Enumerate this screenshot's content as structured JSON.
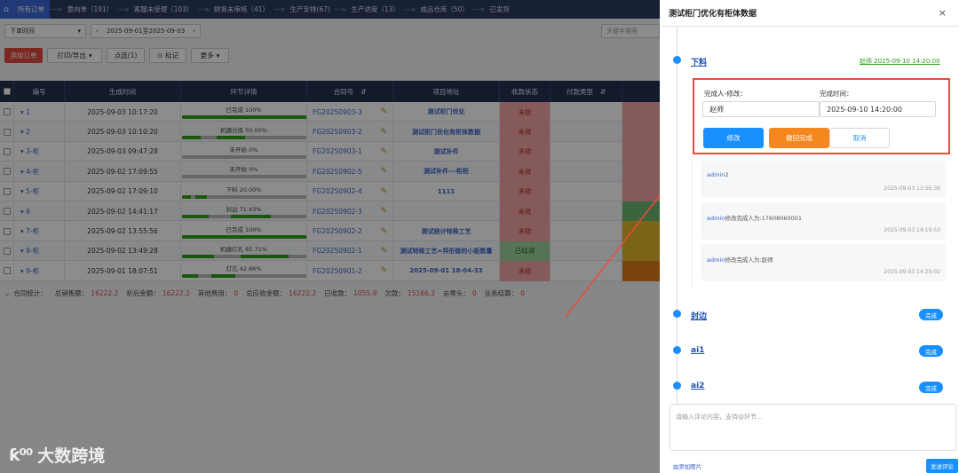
{
  "nav": {
    "home_icon": "home-icon",
    "tabs": [
      {
        "label": "所有订单",
        "active": true
      },
      {
        "label": "意向单（191）"
      },
      {
        "label": "客服未受理（103）"
      },
      {
        "label": "财务未审核（41）"
      },
      {
        "label": "生产安排(67)"
      },
      {
        "label": "生产进度（13）"
      },
      {
        "label": "成品仓库（50）"
      },
      {
        "label": "已发货"
      }
    ],
    "arrow": "--->"
  },
  "filters": {
    "time_select": "下单时间",
    "date_range": "2025-09-01至2025-09-03",
    "keyword_placeholder": "关键字搜索"
  },
  "toolbar": {
    "add": "添加订单",
    "print_export": "打印/导出",
    "pick": "点选(1)",
    "mark": "标记",
    "more": "更多"
  },
  "table": {
    "headers": [
      "编号",
      "生成时间",
      "环节详情",
      "合同号",
      "项目地址",
      "收款状态",
      "付款类型"
    ],
    "sort_icon": "⇵",
    "rows": [
      {
        "id": "1",
        "time": "2025-09-03 10:17:20",
        "stage": "已完成 100%",
        "progress": 1.0,
        "contract": "FG20250903-3",
        "project": "测试柜门优化",
        "status": "未收",
        "color": "#f2a4a4"
      },
      {
        "id": "2",
        "time": "2025-09-03 10:10:20",
        "stage": "机器分拣 50.00%",
        "progress": 0.5,
        "contract": "FG20250903-2",
        "project": "测试柜门优化有柜体数据",
        "status": "未收",
        "color": "#f2a4a4"
      },
      {
        "id": "3-柜",
        "time": "2025-09-03 09:47:28",
        "stage": "未开始 0%",
        "progress": 0,
        "contract": "FG20250903-1",
        "project": "测试补件",
        "status": "未收",
        "color": "#f2a4a4"
      },
      {
        "id": "4-柜",
        "time": "2025-09-02 17:09:55",
        "stage": "未开始 0%",
        "progress": 0,
        "contract": "FG20250902-5",
        "project": "测试补件---柜柜",
        "status": "未收",
        "color": "#f2a4a4"
      },
      {
        "id": "5-柜",
        "time": "2025-09-02 17:09:10",
        "stage": "下料 20.00%",
        "progress": 0.2,
        "contract": "FG20250902-4",
        "project": "1111",
        "status": "未收",
        "color": "#f2a4a4"
      },
      {
        "id": "6",
        "time": "2025-09-02 14:41:17",
        "stage": "封边 71.43%",
        "progress": 0.7143,
        "contract": "FG20250902-3",
        "project": "",
        "status": "未收",
        "color": "#6fb86f"
      },
      {
        "id": "7-柜",
        "time": "2025-09-02 13:55:56",
        "stage": "已完成 100%",
        "progress": 1.0,
        "contract": "FG20250902-2",
        "project": "测试统计特殊工艺",
        "status": "未收",
        "color": "#e0b52a"
      },
      {
        "id": "8-柜",
        "time": "2025-09-02 13:49:28",
        "stage": "机器打孔 85.71%",
        "progress": 0.8571,
        "contract": "FG20250902-1",
        "project": "测试特殊工艺=异形做的小板数量",
        "status": "已结清",
        "color": "#e0b52a"
      },
      {
        "id": "9-柜",
        "time": "2025-09-01 18:07:51",
        "stage": "打孔 42.86%",
        "progress": 0.4286,
        "contract": "FG20250901-2",
        "project": "2025-09-01 18-04-33",
        "status": "未收",
        "color": "#e07a1a"
      }
    ]
  },
  "summary": {
    "label": "合同统计：",
    "items": [
      {
        "label": "总销售额：",
        "value": "16222.2"
      },
      {
        "label": "折后金额：",
        "value": "16222.2"
      },
      {
        "label": "其他费用：",
        "value": "0"
      },
      {
        "label": "总应收金额：",
        "value": "16222.2"
      },
      {
        "label": "已收款：",
        "value": "1055.9"
      },
      {
        "label": "欠款：",
        "value": "15166.3"
      },
      {
        "label": "去零头：",
        "value": "0"
      },
      {
        "label": "业务结算：",
        "value": "0"
      }
    ]
  },
  "drawer": {
    "title": "测试柜门优化有柜体数据",
    "close_icon": "×",
    "step_xialiao": {
      "label": "下料",
      "meta": "赵师 2025-09-10 14:20:00"
    },
    "edit": {
      "person_label": "完成人-修改：",
      "person_value": "赵师",
      "time_label": "完成时间：",
      "time_value": "2025-09-10 14:20:00",
      "modify_btn": "修改",
      "revoke_btn": "撤回完成",
      "cancel_btn": "取消"
    },
    "comments": [
      {
        "user": "admin",
        "text": "2",
        "time": "2025-09-03 13:56:36"
      },
      {
        "user": "admin",
        "text": "修改完成人为:17608060001",
        "time": "2025-09-03 14:19:53"
      },
      {
        "user": "admin",
        "text": "修改完成人为:赵师",
        "time": "2025-09-03 14:20:02"
      }
    ],
    "steps": [
      {
        "label": "封边",
        "badge": "完成"
      },
      {
        "label": "ai1",
        "badge": "完成"
      },
      {
        "label": "ai2",
        "badge": "完成"
      }
    ],
    "comment_placeholder": "请输入评论内容，支持@环节...",
    "add_image": "添加图片",
    "send": "发送评论"
  },
  "watermark": {
    "logo": "ƙ⁰⁰",
    "text": "大数跨境"
  },
  "colors": {
    "accent": "#1890ff",
    "danger": "#e74c3c",
    "revoke": "#f5871f"
  }
}
